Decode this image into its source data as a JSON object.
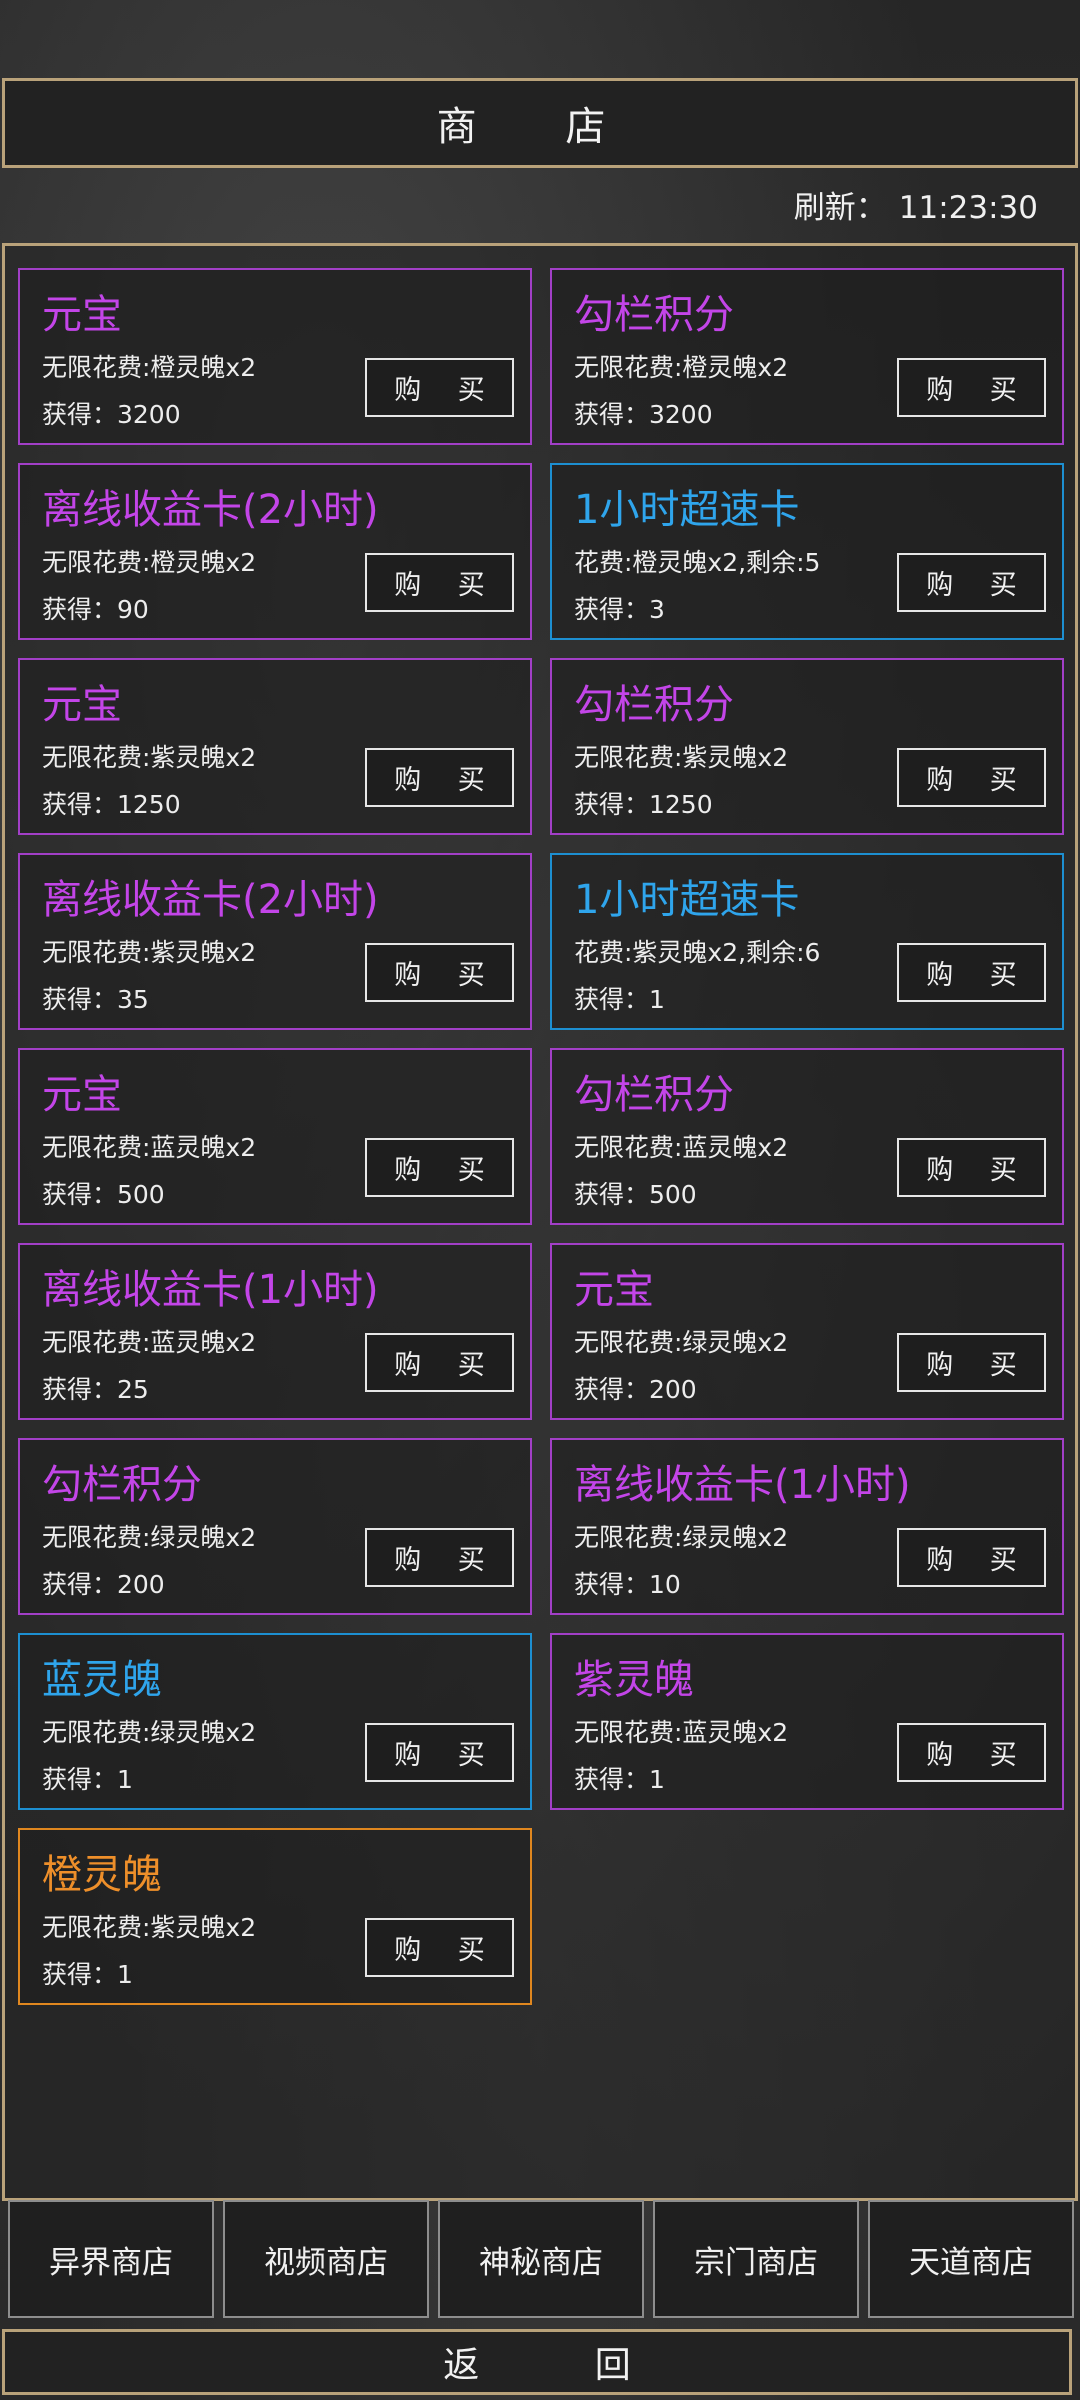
{
  "header": {
    "title": "商 店"
  },
  "refresh": {
    "label": "刷新：",
    "time": "11:23:30"
  },
  "buy_label": "购 买",
  "items": [
    {
      "name": "元宝",
      "cost": "无限花费:橙灵魄x2",
      "gain": "获得：3200",
      "color": "purple"
    },
    {
      "name": "勾栏积分",
      "cost": "无限花费:橙灵魄x2",
      "gain": "获得：3200",
      "color": "purple"
    },
    {
      "name": "离线收益卡(2小时)",
      "cost": "无限花费:橙灵魄x2",
      "gain": "获得：90",
      "color": "purple"
    },
    {
      "name": "1小时超速卡",
      "cost": "花费:橙灵魄x2,剩余:5",
      "gain": "获得：3",
      "color": "blue"
    },
    {
      "name": "元宝",
      "cost": "无限花费:紫灵魄x2",
      "gain": "获得：1250",
      "color": "purple"
    },
    {
      "name": "勾栏积分",
      "cost": "无限花费:紫灵魄x2",
      "gain": "获得：1250",
      "color": "purple"
    },
    {
      "name": "离线收益卡(2小时)",
      "cost": "无限花费:紫灵魄x2",
      "gain": "获得：35",
      "color": "purple"
    },
    {
      "name": "1小时超速卡",
      "cost": "花费:紫灵魄x2,剩余:6",
      "gain": "获得：1",
      "color": "blue"
    },
    {
      "name": "元宝",
      "cost": "无限花费:蓝灵魄x2",
      "gain": "获得：500",
      "color": "purple"
    },
    {
      "name": "勾栏积分",
      "cost": "无限花费:蓝灵魄x2",
      "gain": "获得：500",
      "color": "purple"
    },
    {
      "name": "离线收益卡(1小时)",
      "cost": "无限花费:蓝灵魄x2",
      "gain": "获得：25",
      "color": "purple"
    },
    {
      "name": "元宝",
      "cost": "无限花费:绿灵魄x2",
      "gain": "获得：200",
      "color": "purple"
    },
    {
      "name": "勾栏积分",
      "cost": "无限花费:绿灵魄x2",
      "gain": "获得：200",
      "color": "purple"
    },
    {
      "name": "离线收益卡(1小时)",
      "cost": "无限花费:绿灵魄x2",
      "gain": "获得：10",
      "color": "purple"
    },
    {
      "name": "蓝灵魄",
      "cost": "无限花费:绿灵魄x2",
      "gain": "获得：1",
      "color": "blue"
    },
    {
      "name": "紫灵魄",
      "cost": "无限花费:蓝灵魄x2",
      "gain": "获得：1",
      "color": "purple"
    },
    {
      "name": "橙灵魄",
      "cost": "无限花费:紫灵魄x2",
      "gain": "获得：1",
      "color": "orange"
    }
  ],
  "tabs": [
    "异界商店",
    "视频商店",
    "神秘商店",
    "宗门商店",
    "天道商店"
  ],
  "footer": {
    "back_label": "返 回"
  },
  "colors": {
    "purple": "#c345e8",
    "blue": "#2fa5ec",
    "orange": "#ee8f2a",
    "frame": "#b9a27a"
  }
}
